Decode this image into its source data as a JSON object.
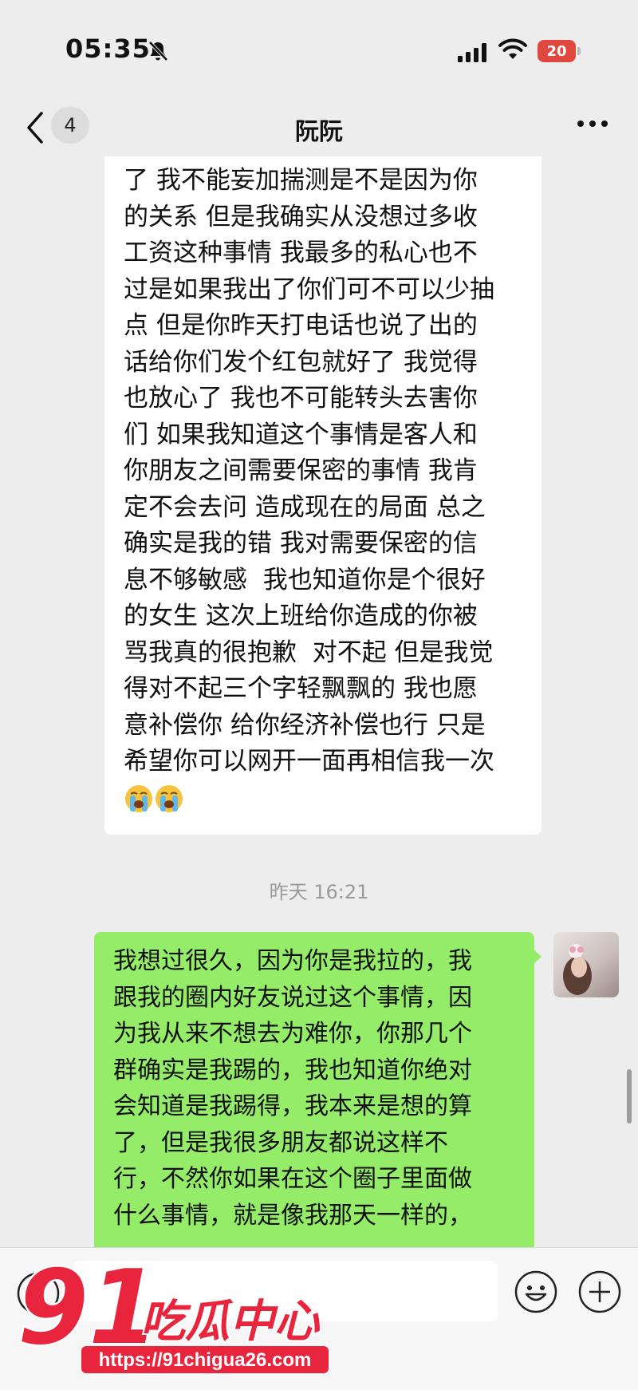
{
  "status_bar": {
    "time": "05:35",
    "battery": "20",
    "icons": [
      "bell-slash-icon",
      "signal-icon",
      "wifi-icon",
      "battery-icon"
    ]
  },
  "nav": {
    "back_icon": "chevron-left-icon",
    "unread_count": "4",
    "title": "阮阮",
    "more_icon": "more-horizontal-icon"
  },
  "messages": [
    {
      "side": "received",
      "text": "了 我不能妄加揣测是不是因为你\n的关系 但是我确实从没想过多收\n工资这种事情 我最多的私心也不\n过是如果我出了你们可不可以少抽\n点 但是你昨天打电话也说了出的\n话给你们发个红包就好了 我觉得\n也放心了 我也不可能转头去害你\n们 如果我知道这个事情是客人和\n你朋友之间需要保密的事情 我肯\n定不会去问 造成现在的局面 总之\n确实是我的错 我对需要保密的信\n息不够敏感  我也知道你是个很好\n的女生 这次上班给你造成的你被\n骂我真的很抱歉  对不起 但是我觉\n得对不起三个字轻飘飘的 我也愿\n意补偿你 给你经济补偿也行 只是\n希望你可以网开一面再相信我一次",
      "emojis": [
        "loudly-crying-face-icon",
        "loudly-crying-face-icon"
      ]
    },
    {
      "side": "sent",
      "text": "我想过很久，因为你是我拉的，我\n跟我的圈内好友说过这个事情，因\n为我从来不想去为难你，你那几个\n群确实是我踢的，我也知道你绝对\n会知道是我踢得，我本来是想的算\n了，但是我很多朋友都说这样不\n行，不然你如果在这个圈子里面做\n什么事情，就是像我那天一样的，"
    }
  ],
  "timestamp": "昨天 16:21",
  "input_bar": {
    "voice_icon": "voice-icon",
    "placeholder": "",
    "emoji_icon": "smiley-icon",
    "plus_icon": "plus-circle-icon"
  },
  "watermark": {
    "number": "91",
    "brand": "吃瓜中心",
    "url": "https://91chigua26.com"
  },
  "colors": {
    "background": "#ededed",
    "sent_bubble": "#95ec69",
    "received_bubble": "#ffffff",
    "battery": "#e0473e",
    "watermark_red": "#e8253d"
  }
}
